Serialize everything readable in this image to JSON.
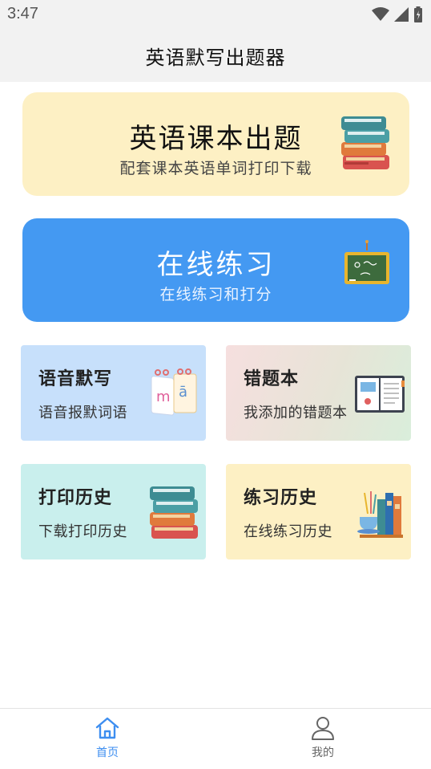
{
  "status_bar": {
    "time": "3:47"
  },
  "header": {
    "title": "英语默写出题器"
  },
  "cards": {
    "textbook": {
      "title": "英语课本出题",
      "subtitle": "配套课本英语单词打印下载",
      "icon": "books-stack-icon"
    },
    "online": {
      "title": "在线练习",
      "subtitle": "在线练习和打分",
      "icon": "chalkboard-icon"
    }
  },
  "tiles": {
    "dictation": {
      "title": "语音默写",
      "subtitle": "语音报默词语",
      "icon": "pinyin-flipbook-icon"
    },
    "wrong_book": {
      "title": "错题本",
      "subtitle": "我添加的错题本",
      "icon": "open-notebook-icon"
    },
    "print_history": {
      "title": "打印历史",
      "subtitle": "下载打印历史",
      "icon": "books-stack-icon"
    },
    "practice_history": {
      "title": "练习历史",
      "subtitle": "在线练习历史",
      "icon": "study-desk-icon"
    }
  },
  "bottom_nav": {
    "home": {
      "label": "首页",
      "icon": "home-icon",
      "active": true
    },
    "mine": {
      "label": "我的",
      "icon": "user-icon",
      "active": false
    }
  },
  "colors": {
    "accent": "#4499f2",
    "yellow_card": "#fdf0c4",
    "blue_tile": "#c7e0fb",
    "teal_tile": "#c9efed",
    "nav_active": "#3d8ef0"
  }
}
